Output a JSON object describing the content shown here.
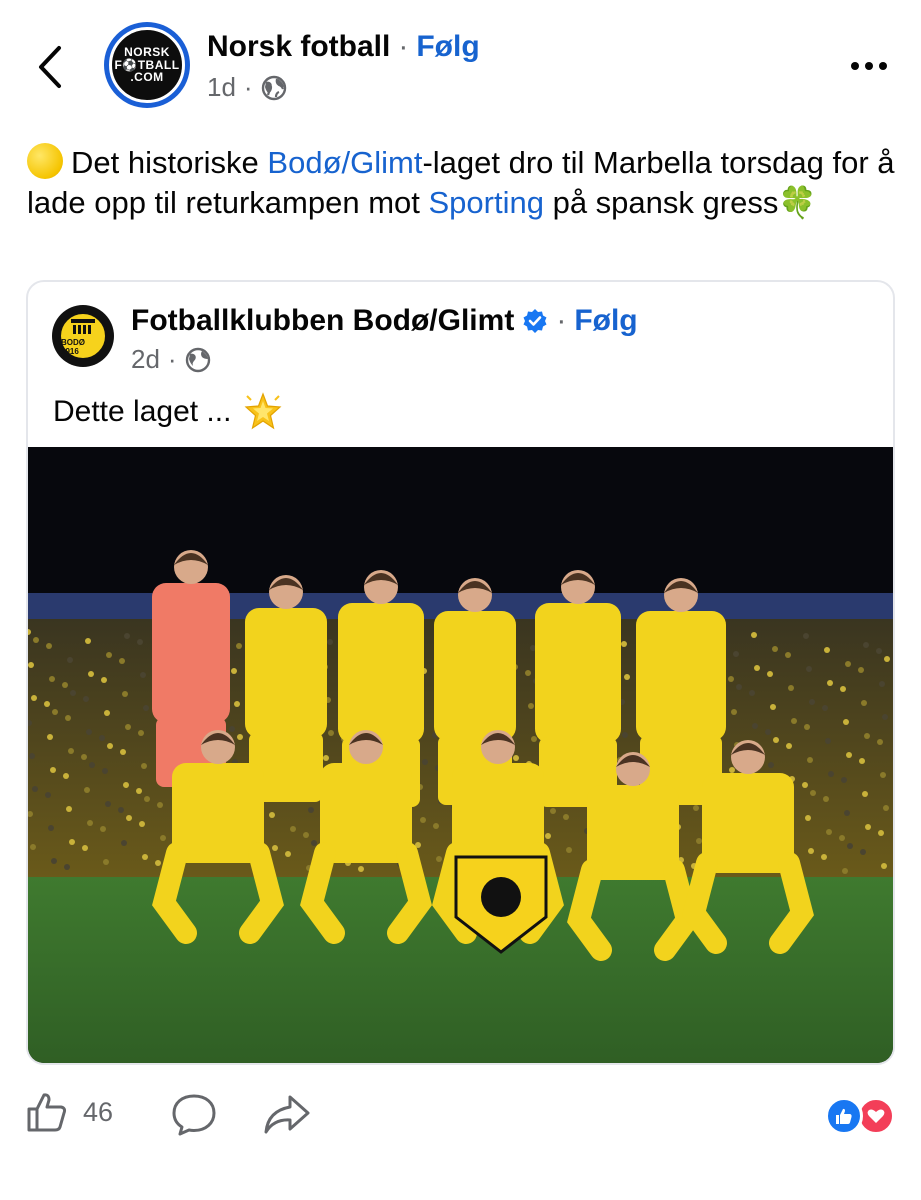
{
  "header": {
    "back_icon": "chevron-left-icon",
    "avatar_text": [
      "NORSK",
      "F⚽TBALL",
      ".COM"
    ],
    "page_name": "Norsk fotball",
    "separator": "·",
    "follow_label": "Følg",
    "time": "1d",
    "meta_separator": "·",
    "privacy_icon": "globe-icon",
    "more_icon": "more-horizontal-icon"
  },
  "post": {
    "lead_emoji": "yellow-circle-emoji",
    "text_1": "Det historiske ",
    "link_1": "Bodø/Glimt",
    "text_2": "-laget dro til Marbella torsdag for å lade opp til returkampen mot ",
    "link_2": "Sporting",
    "text_3": " på spansk gress",
    "trail_emoji": "🍀"
  },
  "shared": {
    "club_name": "Fotballklubben Bodø/Glimt",
    "logo_text": "BODØ 1916",
    "verified_icon": "verified-badge-icon",
    "separator": "·",
    "follow_label": "Følg",
    "time": "2d",
    "meta_separator": "·",
    "privacy_icon": "globe-icon",
    "text": "Dette laget ...",
    "text_emoji": "glowing-star-icon",
    "photo_alt": "team-photo"
  },
  "actions": {
    "like_icon": "thumbs-up-icon",
    "like_count": "46",
    "comment_icon": "comment-icon",
    "share_icon": "share-icon",
    "reactions": [
      "like",
      "love"
    ]
  },
  "colors": {
    "link": "#1763cf",
    "meta": "#65676b",
    "text": "#050505",
    "card_border": "#e4e6eb",
    "like_blue": "#1877f2",
    "love_red": "#f33e58",
    "kit_yellow": "#f2d31d",
    "keeper_pink": "#f07a66"
  }
}
